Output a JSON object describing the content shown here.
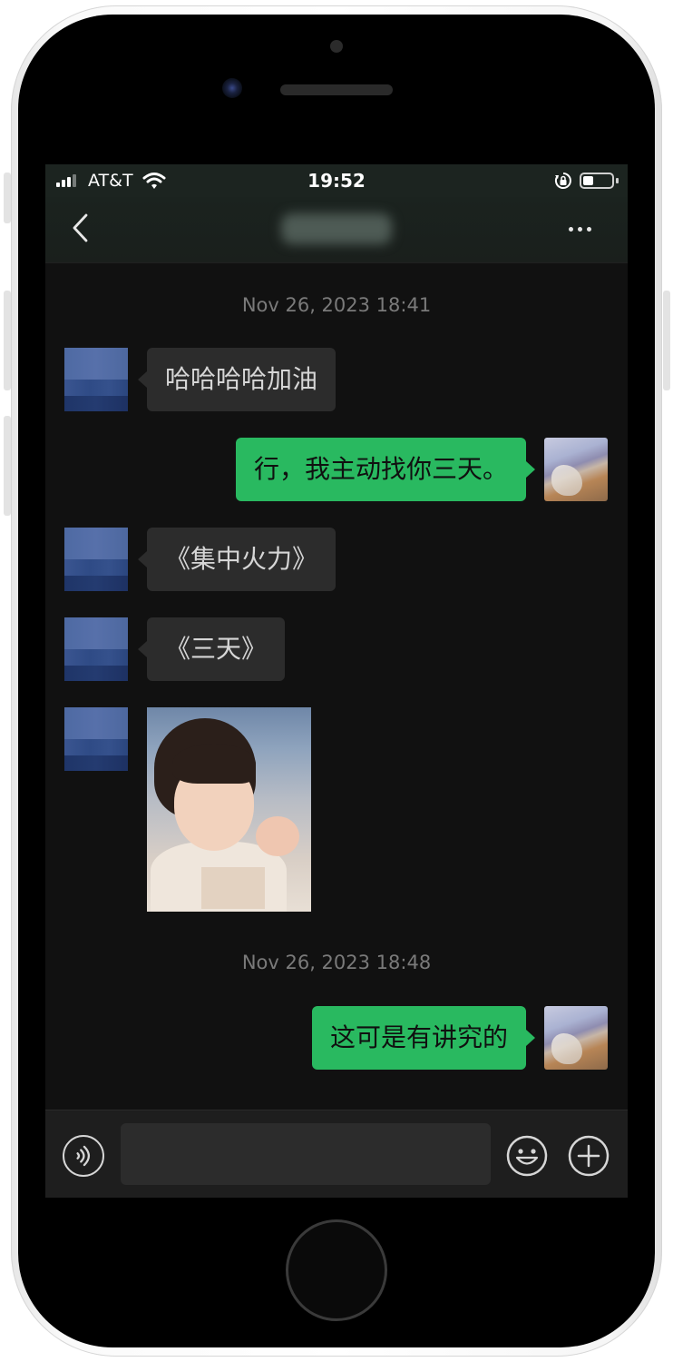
{
  "status_bar": {
    "carrier": "AT&T",
    "time": "19:52",
    "battery_level": 0.35
  },
  "nav": {
    "title": "·······",
    "back_icon": "chevron-left-icon",
    "more_icon": "ellipsis-icon"
  },
  "messages": [
    {
      "type": "timestamp",
      "text": "Nov 26, 2023 18:41"
    },
    {
      "type": "text",
      "direction": "incoming",
      "text": "哈哈哈哈加油"
    },
    {
      "type": "text",
      "direction": "outgoing",
      "text": "行，我主动找你三天。"
    },
    {
      "type": "text",
      "direction": "incoming",
      "text": "《集中火力》"
    },
    {
      "type": "text",
      "direction": "incoming",
      "text": "《三天》"
    },
    {
      "type": "sticker",
      "direction": "incoming"
    },
    {
      "type": "timestamp",
      "text": "Nov 26, 2023 18:48"
    },
    {
      "type": "text",
      "direction": "outgoing",
      "text": "这可是有讲究的"
    }
  ],
  "input_bar": {
    "placeholder": "",
    "icons": [
      "voice-icon",
      "emoji-icon",
      "plus-icon"
    ]
  },
  "colors": {
    "outgoing_bubble": "#29b960",
    "incoming_bubble": "#2c2c2c",
    "background": "#111111"
  }
}
